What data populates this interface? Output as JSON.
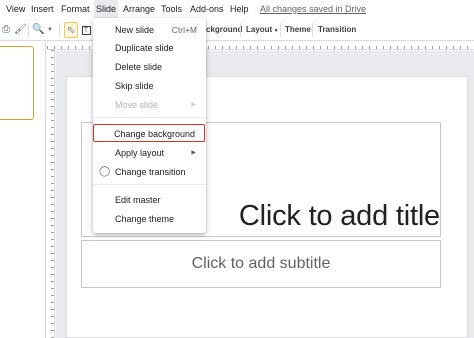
{
  "menubar": {
    "items": [
      "View",
      "Insert",
      "Format",
      "Slide",
      "Arrange",
      "Tools",
      "Add-ons",
      "Help"
    ],
    "saved_status": "All changes saved in Drive"
  },
  "toolbar": {
    "background_partial": "ckground",
    "layout_label": "Layout",
    "theme_label": "Theme",
    "transition_label": "Transition"
  },
  "slide_menu": {
    "new_slide": "New slide",
    "new_slide_shortcut": "Ctrl+M",
    "duplicate_slide": "Duplicate slide",
    "delete_slide": "Delete slide",
    "skip_slide": "Skip slide",
    "move_slide": "Move slide",
    "change_background": "Change background",
    "apply_layout": "Apply layout",
    "change_transition": "Change transition",
    "edit_master": "Edit master",
    "change_theme": "Change theme"
  },
  "slide": {
    "title_placeholder": "Click to add title",
    "subtitle_placeholder": "Click to add subtitle"
  },
  "colors": {
    "highlight_border": "#d93025",
    "active_menu_bg": "#e8eaed",
    "thumbnail_border": "#d3a32a"
  }
}
